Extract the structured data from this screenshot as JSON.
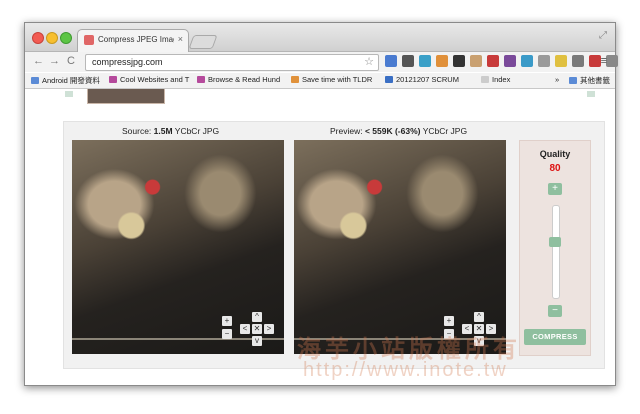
{
  "browser": {
    "tab_title": "Compress JPEG Images On",
    "tab_close": "×",
    "url": "compressjpg.com",
    "back": "←",
    "forward": "→",
    "reload": "C",
    "star": "☆",
    "menu": "≡",
    "expand": "⤢"
  },
  "bookmarks": [
    {
      "label": "Android 開發資料",
      "color": "#5b8bd6"
    },
    {
      "label": "Cool Websites and T",
      "color": "#b54a9c"
    },
    {
      "label": "Browse & Read Hund",
      "color": "#b54a9c"
    },
    {
      "label": "Save time with TLDR",
      "color": "#e0913a"
    },
    {
      "label": "20121207 SCRUM",
      "color": "#3a6fc4"
    },
    {
      "label": "Index",
      "color": "#cccccc"
    }
  ],
  "bookmarks_more": "»",
  "bookmarks_other": "其他書籤",
  "extensions": [
    "#4a7bd0",
    "#555555",
    "#3aa0c8",
    "#e0903a",
    "#333333",
    "#c9a070",
    "#c83a3a",
    "#7a4a9a",
    "#3a9ac8",
    "#9a9a9a",
    "#e0c040",
    "#7a7a7a",
    "#c83a3a",
    "#888888"
  ],
  "compressor": {
    "source_prefix": "Source: ",
    "source_size": "1.5M",
    "source_suffix": " YCbCr JPG",
    "preview_prefix": "Preview: ",
    "preview_size": "< 559K (-63%)",
    "preview_suffix": " YCbCr JPG",
    "zoom_in": "+",
    "zoom_out": "−",
    "pan_up": "^",
    "pan_down": "v",
    "pan_left": "<",
    "pan_right": ">",
    "reset": "✕",
    "quality_label": "Quality",
    "quality_value": "80",
    "quality_plus": "+",
    "quality_minus": "−",
    "compress_label": "COMPRESS"
  },
  "watermark_line1": "海芋小站版權所有",
  "watermark_line2": "http://www.inote.tw"
}
